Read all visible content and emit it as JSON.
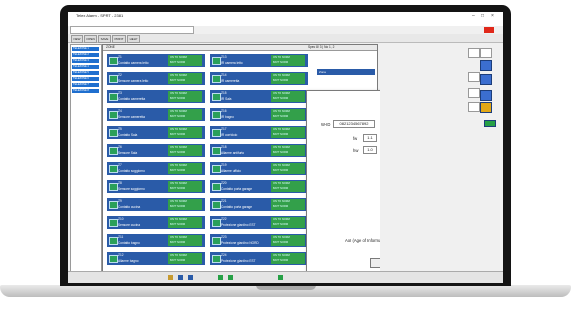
{
  "app": {
    "title": "Telex Alarm - SPRT - 2381"
  },
  "toolbar": {
    "buttons": [
      "NEW",
      "OPEN",
      "SAVE",
      "PRINT",
      "HELP"
    ]
  },
  "tree": [
    "TELEZONE 1",
    "TELEZONE 2",
    "TELEZONE 3",
    "TELEZONE 4",
    "TELEZONE 5",
    "TELEZONE 6",
    "TELEZONE 7",
    "TELEZONE 8"
  ],
  "panel": {
    "header": "ZONE",
    "right_label": "Spec 8/ 3 | No 1, 2"
  },
  "zones_left": [
    {
      "code": "Z1",
      "name": "Contatto camera letto",
      "st1": "ON TO NORM",
      "st2": "BATT NORM"
    },
    {
      "code": "Z2",
      "name": "Sensore camera letto",
      "st1": "ON TO NORM",
      "st2": "BATT NORM"
    },
    {
      "code": "Z3",
      "name": "Contatto cameretta",
      "st1": "ON TO NORM",
      "st2": "BATT NORM"
    },
    {
      "code": "Z4",
      "name": "Sensore cameretta",
      "st1": "ON TO NORM",
      "st2": "BATT NORM"
    },
    {
      "code": "Z5",
      "name": "Contatto Sala",
      "st1": "ON TO NORM",
      "st2": "BATT NORM"
    },
    {
      "code": "Z6",
      "name": "Sensore Sala",
      "st1": "ON TO NORM",
      "st2": "BATT NORM"
    },
    {
      "code": "Z7",
      "name": "Contatto soggiorno",
      "st1": "ON TO NORM",
      "st2": "BATT NORM"
    },
    {
      "code": "Z8",
      "name": "Sensore soggiorno",
      "st1": "ON TO NORM",
      "st2": "BATT NORM"
    },
    {
      "code": "Z9",
      "name": "Contatto cucina",
      "st1": "ON TO NORM",
      "st2": "BATT NORM"
    },
    {
      "code": "Z10",
      "name": "Sensore cucina",
      "st1": "ON TO NORM",
      "st2": "BATT NORM"
    },
    {
      "code": "Z11",
      "name": "Contatto bagno",
      "st1": "ON TO NORM",
      "st2": "BATT NORM"
    },
    {
      "code": "Z12",
      "name": "Allarme bagno",
      "st1": "ON TO NORM",
      "st2": "BATT NORM"
    }
  ],
  "zones_right": [
    {
      "code": "Z13",
      "name": "IR camera letto",
      "st1": "ON TO NORM",
      "st2": "BATT NORM"
    },
    {
      "code": "Z14",
      "name": "IR cameretta",
      "st1": "ON TO NORM",
      "st2": "BATT NORM"
    },
    {
      "code": "Z15",
      "name": "IR Sala",
      "st1": "ON TO NORM",
      "st2": "BATT NORM"
    },
    {
      "code": "Z16",
      "name": "IR bagno",
      "st1": "ON TO NORM",
      "st2": "BATT NORM"
    },
    {
      "code": "Z17",
      "name": "IR corridoio",
      "st1": "ON TO NORM",
      "st2": "BATT NORM"
    },
    {
      "code": "Z18",
      "name": "Allarme antifurto",
      "st1": "ON TO NORM",
      "st2": "BATT NORM"
    },
    {
      "code": "Z19",
      "name": "Allarme ufficio",
      "st1": "ON TO NORM",
      "st2": "BATT NORM"
    },
    {
      "code": "Z20",
      "name": "Contatto porta garage",
      "st1": "ON TO NORM",
      "st2": "BATT NORM"
    },
    {
      "code": "Z21",
      "name": "Contatto porta garage",
      "st1": "ON TO NORM",
      "st2": "BATT NORM"
    },
    {
      "code": "Z22",
      "name": "Protezione giardino EST",
      "st1": "ON TO NORM",
      "st2": "BATT NORM"
    },
    {
      "code": "Z23",
      "name": "Protezione giardino NORD",
      "st1": "ON TO NORM",
      "st2": "BATT NORM"
    },
    {
      "code": "Z24",
      "name": "Protezione giardino EST",
      "st1": "ON TO NORM",
      "st2": "BATT NORM"
    }
  ],
  "side_strip": {
    "label": "Zona"
  },
  "popup": {
    "wid_label": "W-ID",
    "wid_value": "0821234567892",
    "fw_label": "fw",
    "fw_value": "1.1",
    "hw_label": "hw",
    "hw_value": "1.0",
    "signal1": "100 %",
    "signal2": "-28 dBm",
    "battery": "100 %",
    "aoi_text": "AoI (Age of Information) : 21min",
    "reset_label": "Reset"
  },
  "colors": {
    "zone_blue": "#2a5ba8",
    "status_green": "#33a04a",
    "accent_red": "#e0281a"
  }
}
